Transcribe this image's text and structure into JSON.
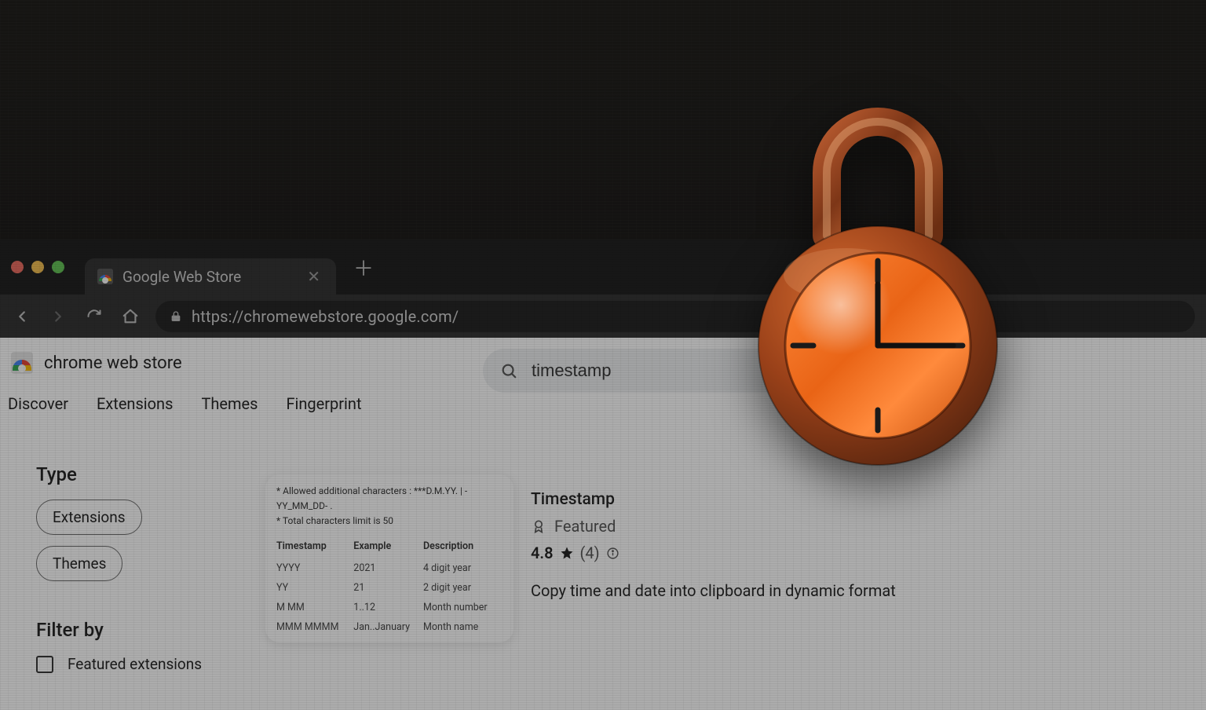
{
  "browser": {
    "tab_title": "Google Web Store",
    "url": "https://chromewebstore.google.com/"
  },
  "store": {
    "brand": "chrome web store",
    "search_value": "timestamp",
    "nav": {
      "discover": "Discover",
      "extensions": "Extensions",
      "themes": "Themes",
      "fingerprint": "Fingerprint"
    }
  },
  "sidebar": {
    "type_heading": "Type",
    "chip_extensions": "Extensions",
    "chip_themes": "Themes",
    "filter_heading": "Filter by",
    "featured_ext_label": "Featured extensions"
  },
  "thumb": {
    "hint1": "* Allowed additional characters : ***D.M.YY. | -YY_MM_DD- .",
    "hint2": "* Total characters limit is 50",
    "headers": {
      "c1": "Timestamp",
      "c2": "Example",
      "c3": "Description"
    },
    "rows": [
      {
        "c1": "YYYY",
        "c2": "2021",
        "c3": "4 digit year"
      },
      {
        "c1": "YY",
        "c2": "21",
        "c3": "2 digit year"
      },
      {
        "c1": "M MM",
        "c2": "1..12",
        "c3": "Month number"
      },
      {
        "c1": "MMM MMMM",
        "c2": "Jan..January",
        "c3": "Month name"
      }
    ]
  },
  "details": {
    "name": "Timestamp",
    "featured_label": "Featured",
    "rating_value": "4.8",
    "rating_count": "(4)",
    "description": "Copy time and date into clipboard in dynamic format"
  }
}
